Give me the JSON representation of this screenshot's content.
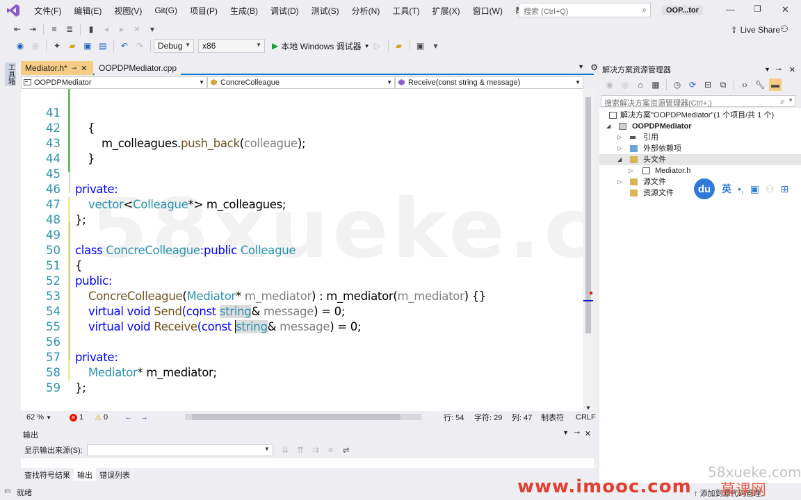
{
  "menubar": {
    "items": [
      "文件(F)",
      "编辑(E)",
      "视图(V)",
      "Git(G)",
      "项目(P)",
      "生成(B)",
      "调试(D)",
      "测试(S)",
      "分析(N)",
      "工具(T)",
      "扩展(X)",
      "窗口(W)",
      "帮助(H)"
    ],
    "search_placeholder": "搜索 (Ctrl+Q)",
    "solution_short": "OOP...tor"
  },
  "toolbar": {
    "config": "Debug",
    "platform": "x86",
    "debugger": "本地 Windows 调试器",
    "live_share": "Live Share"
  },
  "left_strip": {
    "toolbox": "工具箱"
  },
  "tabs": [
    {
      "label": "Mediator.h*"
    },
    {
      "label": "OOPDPMediator.cpp"
    }
  ],
  "navbar": {
    "project": "OOPDPMediator",
    "class": "ConcreColleague",
    "member": "Receive(const string & message)"
  },
  "code": {
    "lines": [
      {
        "n": "41"
      },
      {
        "n": "42"
      },
      {
        "n": "43"
      },
      {
        "n": "44"
      },
      {
        "n": "45"
      },
      {
        "n": "46"
      },
      {
        "n": "47"
      },
      {
        "n": "48"
      },
      {
        "n": "49"
      },
      {
        "n": "50"
      },
      {
        "n": "51"
      },
      {
        "n": "52"
      },
      {
        "n": "53"
      },
      {
        "n": "54"
      },
      {
        "n": "55"
      },
      {
        "n": "56"
      },
      {
        "n": "57"
      },
      {
        "n": "58"
      },
      {
        "n": "59"
      }
    ],
    "text": {
      "l41": "{",
      "l42_a": "m_colleagues.",
      "l42_b": "push_back",
      "l42_c": "(",
      "l42_d": "colleague",
      "l42_e": ");",
      "l43": "}",
      "l45": "private:",
      "l46_a": "vector",
      "l46_b": "<",
      "l46_c": "Colleague",
      "l46_d": "*> m_colleagues;",
      "l47": "};",
      "l49_a": "class ",
      "l49_b": "ConcreColleague",
      "l49_c": ":public ",
      "l49_d": "Colleague",
      "l50": "{",
      "l51": "public:",
      "l52_a": "ConcreColleague",
      "l52_b": "(",
      "l52_c": "Mediator",
      "l52_d": "* ",
      "l52_e": "m_mediator",
      "l52_f": ") : m_mediator(",
      "l52_g": "m_mediator",
      "l52_h": ") {}",
      "l53_a": "virtual void ",
      "l53_b": "Send",
      "l53_c": "(const ",
      "l53_d": "string",
      "l53_e": "& ",
      "l53_f": "message",
      "l53_g": ") = 0;",
      "l54_a": "virtual void ",
      "l54_b": "Receive",
      "l54_c": "(const ",
      "l54_d": "string",
      "l54_e": "& ",
      "l54_f": "message",
      "l54_g": ") = 0;",
      "l56": "private:",
      "l57_a": "Mediator",
      "l57_b": "* m_mediator;",
      "l58": "};"
    }
  },
  "editor_status": {
    "zoom": "62 %",
    "errors": "1",
    "warnings": "0",
    "row": "行: 54",
    "col": "字符: 29",
    "colnum": "列: 47",
    "tabs": "制表符",
    "eol": "CRLF"
  },
  "output": {
    "title": "输出",
    "source_label": "显示输出来源(S):"
  },
  "bottom_tabs": [
    "查找符号结果",
    "输出",
    "错误列表"
  ],
  "solution_explorer": {
    "title": "解决方案资源管理器",
    "search_placeholder": "搜索解决方案资源管理器(Ctrl+;)",
    "items": [
      {
        "label": "解决方案\"OOPDPMediator\"(1 个项目/共 1 个)"
      },
      {
        "label": "OOPDPMediator"
      },
      {
        "label": "引用"
      },
      {
        "label": "外部依赖项"
      },
      {
        "label": "头文件"
      },
      {
        "label": "Mediator.h"
      },
      {
        "label": "源文件"
      },
      {
        "label": "资源文件"
      }
    ]
  },
  "ime": {
    "logo": "du",
    "lang": "英"
  },
  "statusbar": {
    "ready": "就绪",
    "add_source": "添加到源代码管理"
  },
  "watermarks": {
    "big": "58xueke.com",
    "small": "58xueke.com",
    "imooc": "www.imooc.com",
    "kewang": "慕课网"
  },
  "colors": {
    "accent": "#007acc",
    "active_tab": "#f5cc84",
    "keyword": "#0000ff",
    "type": "#2b91af",
    "function": "#74531f",
    "param": "#808080",
    "linenumber": "#2b91af"
  }
}
